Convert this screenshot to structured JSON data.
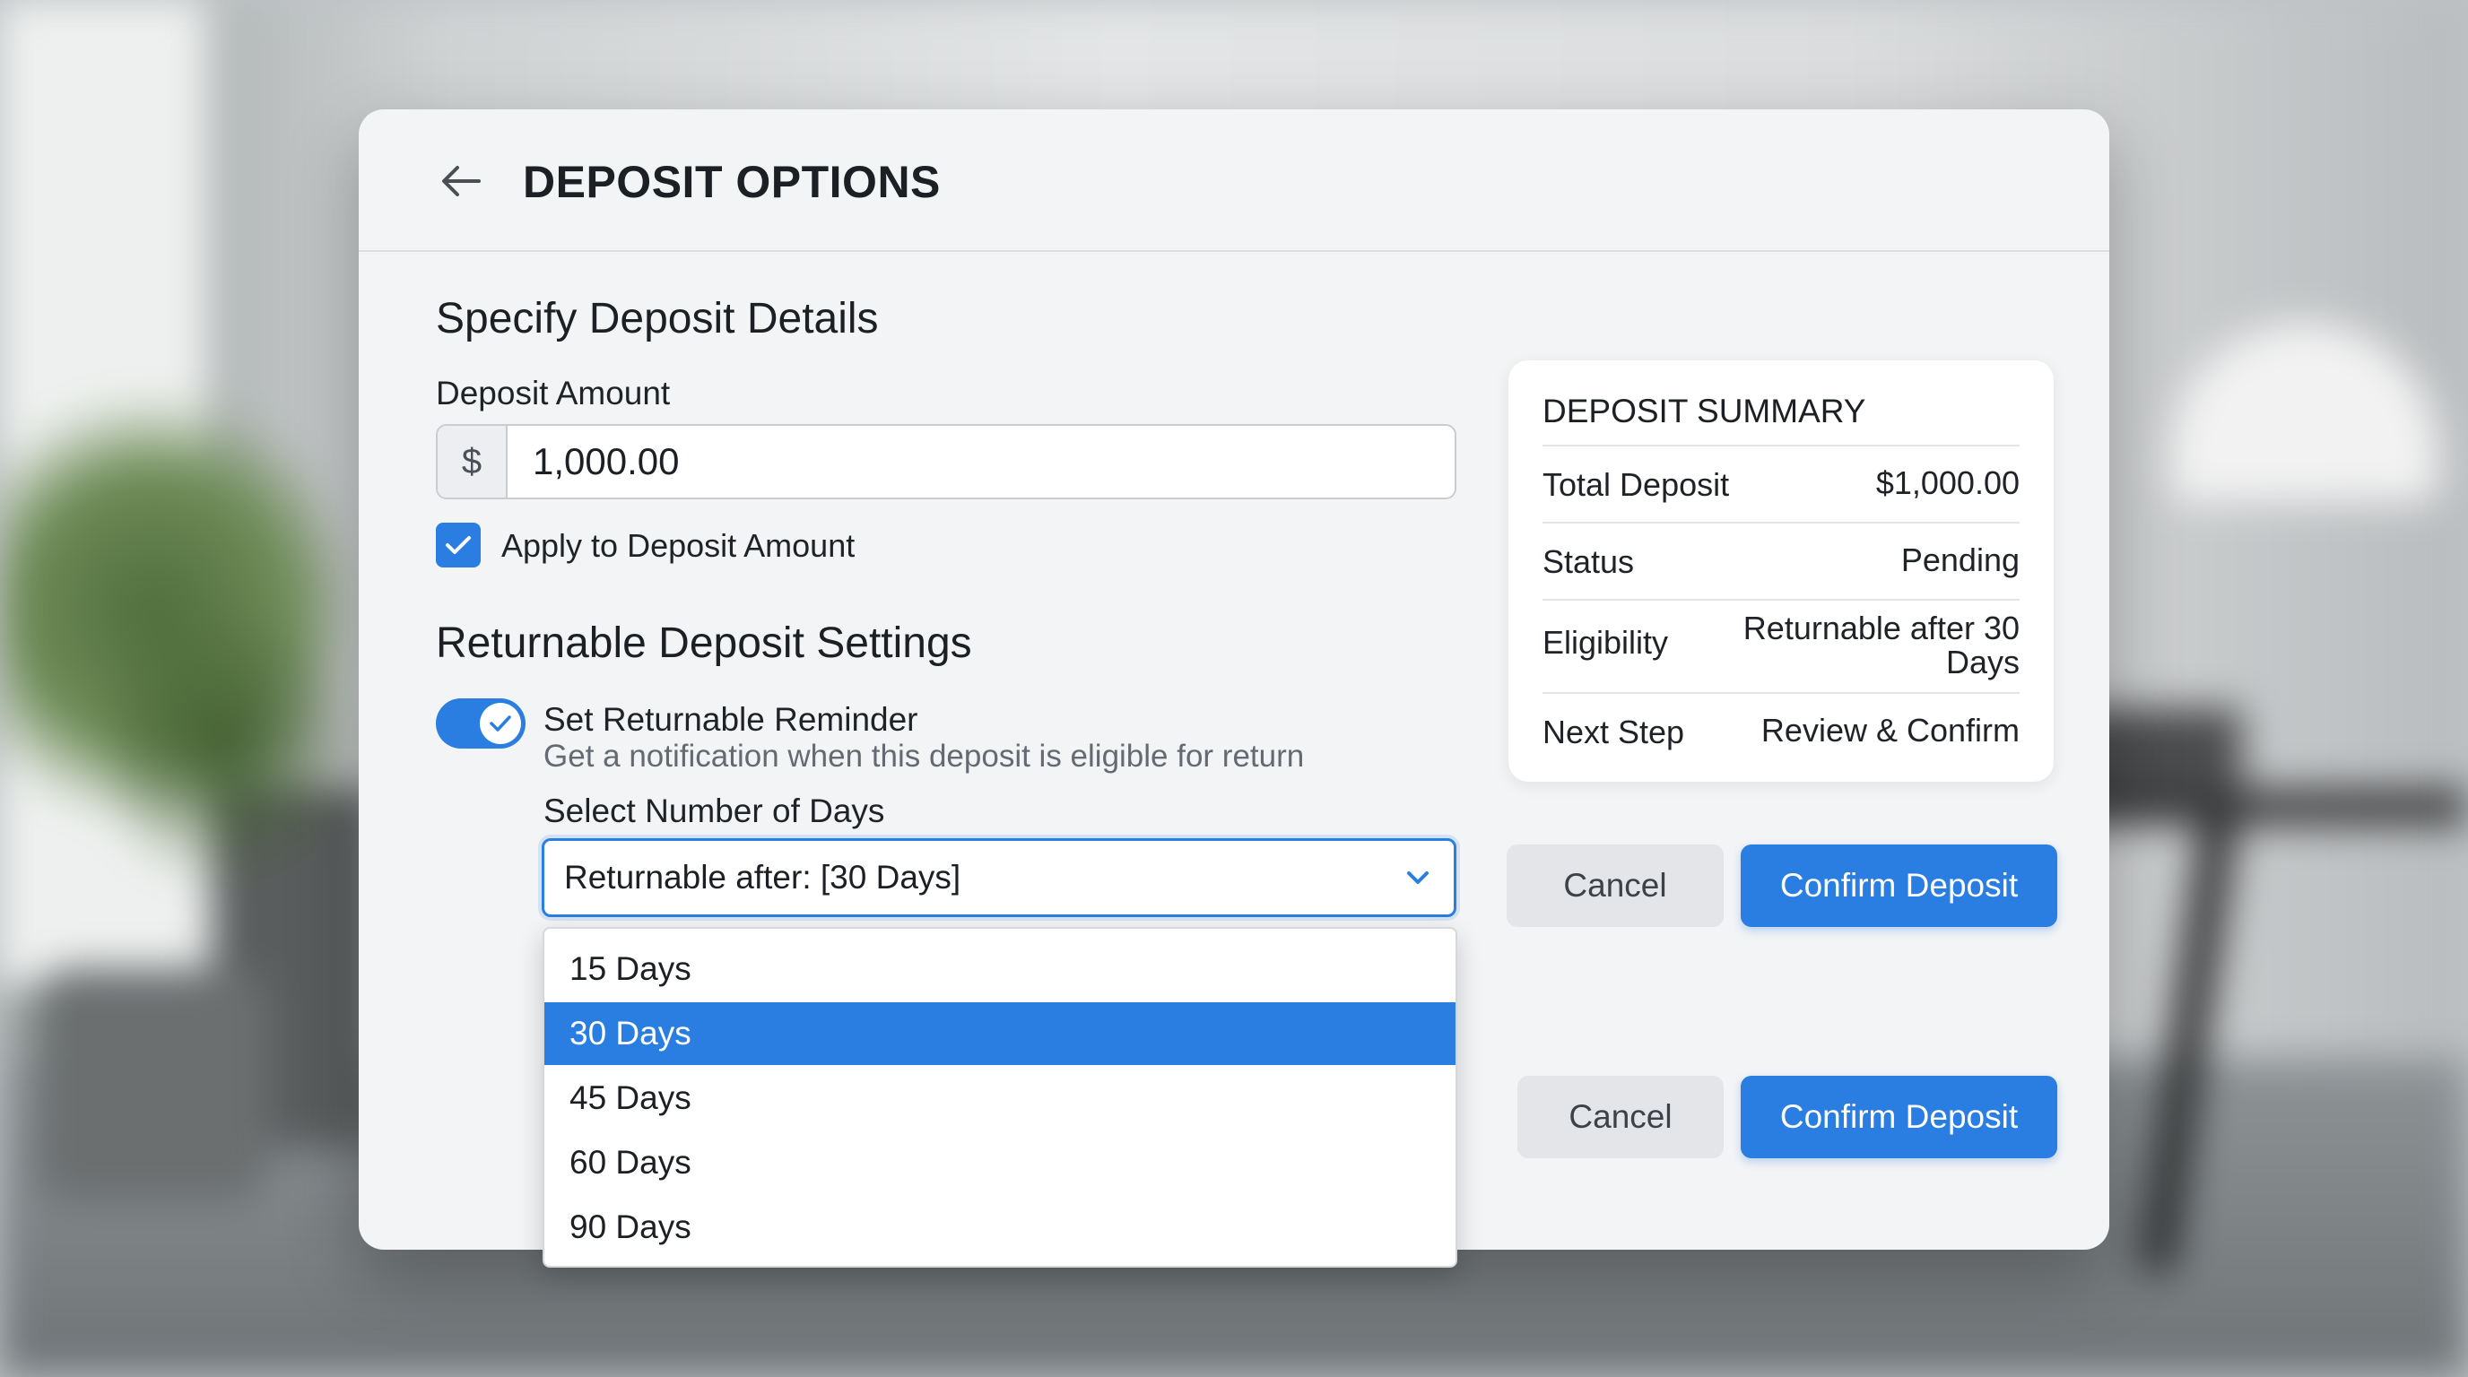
{
  "header": {
    "title": "DEPOSIT OPTIONS",
    "back_icon": "arrow-left-icon"
  },
  "details": {
    "section_title": "Specify Deposit Details",
    "amount_label": "Deposit Amount",
    "currency_symbol": "$",
    "amount_value": "1,000.00",
    "apply_checkbox": {
      "label": "Apply to Deposit Amount",
      "checked": true
    }
  },
  "returnable": {
    "section_title": "Returnable Deposit Settings",
    "reminder_toggle": {
      "label": "Set Returnable Reminder",
      "on": true
    },
    "reminder_description": "Get a notification when this deposit is eligible for return",
    "days_label": "Select Number of Days",
    "days_select_value": "Returnable after: [30 Days]",
    "days_options": [
      "15 Days",
      "30 Days",
      "45 Days",
      "60 Days",
      "90 Days"
    ],
    "selected_option": "30 Days"
  },
  "summary": {
    "title": "DEPOSIT SUMMARY",
    "rows": [
      {
        "label": "Total Deposit",
        "value": "$1,000.00"
      },
      {
        "label": "Status",
        "value": "Pending"
      },
      {
        "label": "Eligibility",
        "value_line1": "Returnable after 30",
        "value_line2": "Days"
      },
      {
        "label": "Next Step",
        "value": "Review & Confirm"
      }
    ]
  },
  "actions": {
    "cancel_label": "Cancel",
    "confirm_label": "Confirm Deposit"
  },
  "colors": {
    "accent": "#2a7de1",
    "card": "#f3f4f6",
    "cancel_bg": "#e3e5e8"
  }
}
